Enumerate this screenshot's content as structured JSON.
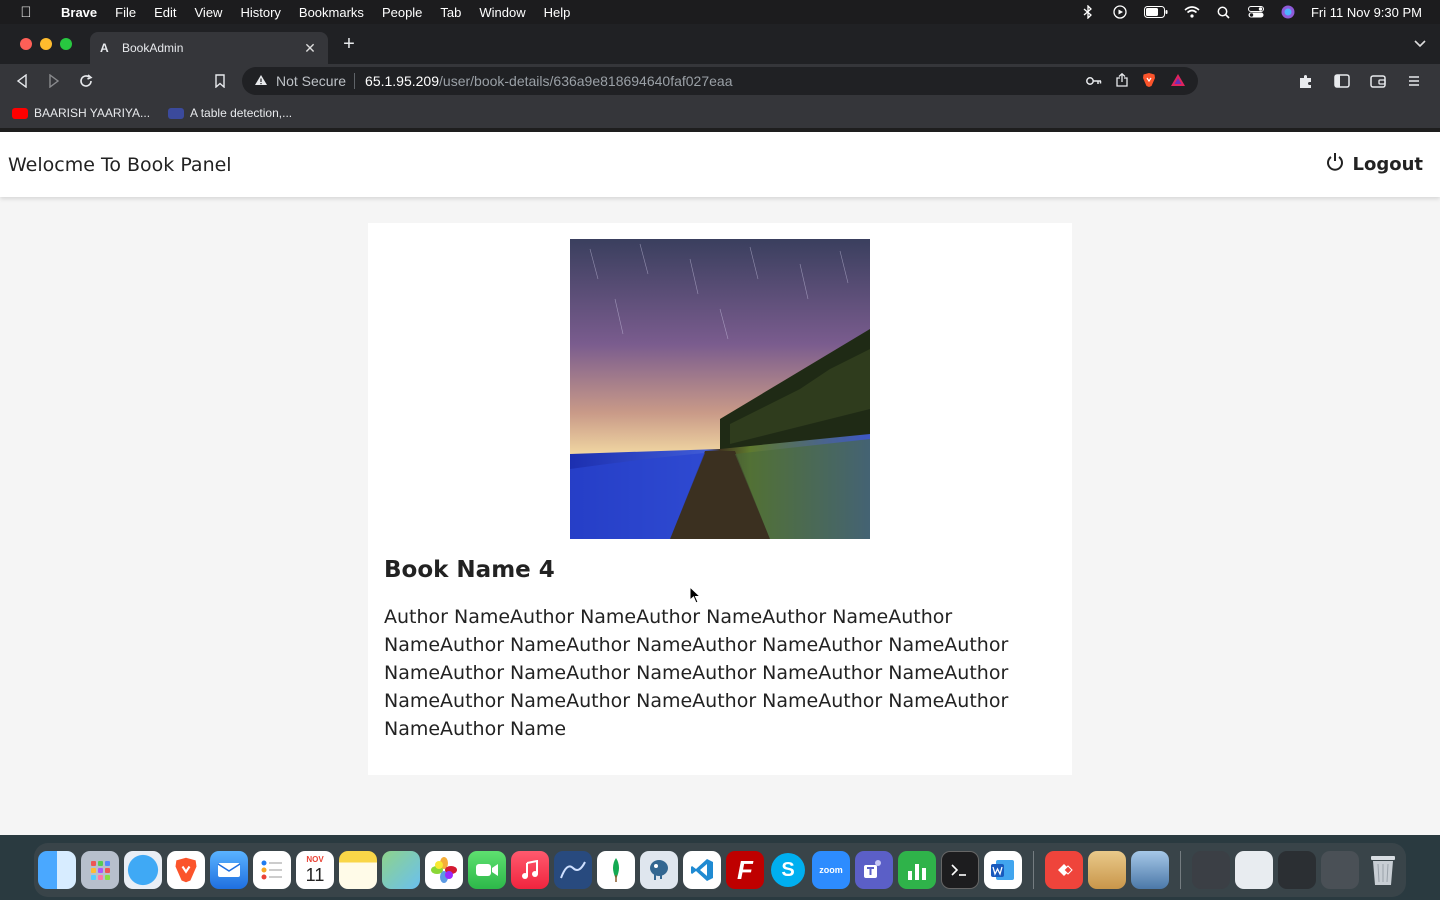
{
  "menubar": {
    "app_name": "Brave",
    "items": [
      "File",
      "Edit",
      "View",
      "History",
      "Bookmarks",
      "People",
      "Tab",
      "Window",
      "Help"
    ],
    "datetime": "Fri 11 Nov  9:30 PM"
  },
  "browser": {
    "tab_title": "BookAdmin",
    "tab_favicon": "A",
    "security_label": "Not Secure",
    "url_host": "65.1.95.209",
    "url_path": "/user/book-details/636a9e818694640faf027eaa"
  },
  "bookmarks": [
    {
      "label": "BAARISH YAARIYA...",
      "icon": "youtube-icon",
      "color": "#ff0000"
    },
    {
      "label": "A table detection,...",
      "icon": "tds-icon",
      "color": "#3b4a9c"
    }
  ],
  "app": {
    "brand": "Welocme To Book Panel",
    "logout_label": "Logout"
  },
  "book": {
    "name": "Book Name 4",
    "author": "Author NameAuthor NameAuthor NameAuthor NameAuthor NameAuthor NameAuthor NameAuthor NameAuthor NameAuthor NameAuthor NameAuthor NameAuthor NameAuthor NameAuthor NameAuthor NameAuthor NameAuthor NameAuthor NameAuthor NameAuthor Name",
    "cover": "landscape-image"
  },
  "dock": {
    "calendar_month": "NOV",
    "calendar_day": "11",
    "zoom_label": "zoom"
  }
}
